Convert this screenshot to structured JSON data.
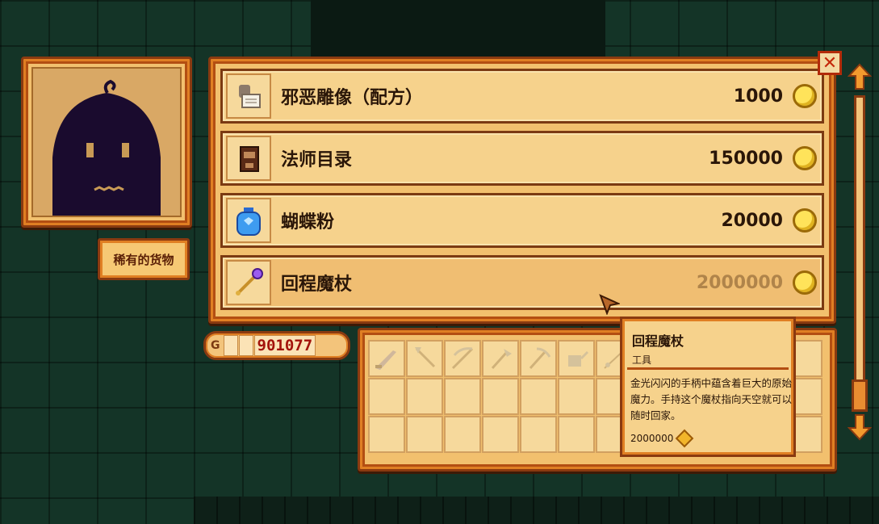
{
  "shop_list": [
    {
      "name": "邪恶雕像（配方）",
      "price": "1000",
      "icon": "statue-recipe-icon"
    },
    {
      "name": "法师目录",
      "price": "150000",
      "icon": "catalogue-icon"
    },
    {
      "name": "蝴蝶粉",
      "price": "20000",
      "icon": "butterfly-powder-icon"
    },
    {
      "name": "回程魔杖",
      "price": "2000000",
      "icon": "return-scepter-icon"
    }
  ],
  "tag_label": "稀有的货物",
  "money": {
    "prefix": "G",
    "value": "901077"
  },
  "close_label": "✕",
  "tooltip": {
    "title": "回程魔杖",
    "type": "工具",
    "description": "金光闪闪的手柄中蕴含着巨大的原始魔力。手持这个魔杖指向天空就可以随时回家。",
    "price": "2000000"
  },
  "inventory_tools": [
    "sword-icon",
    "hoe-icon",
    "scythe-icon",
    "axe-icon",
    "pickaxe-icon",
    "watering-can-icon",
    "rod-icon"
  ],
  "colors": {
    "wood": "#f2c06e",
    "border": "#8a3a10",
    "accent": "#e07f23",
    "money_red": "#a3130b"
  }
}
